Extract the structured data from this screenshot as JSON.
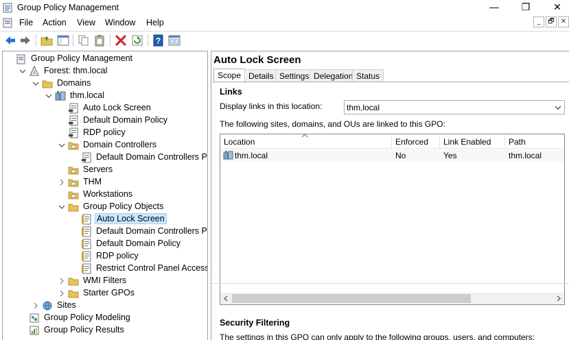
{
  "window": {
    "title": "Group Policy Management",
    "minimize_glyph": "—",
    "maximize_glyph": "❐",
    "close_glyph": "✕"
  },
  "menu": [
    "File",
    "Action",
    "View",
    "Window",
    "Help"
  ],
  "mdi": {
    "minimize": "_",
    "restore": "🗗",
    "close": "✕"
  },
  "toolbar": [
    "back-icon",
    "forward-icon",
    "up-folder-icon",
    "show-tree-icon",
    "copy-icon",
    "paste-icon",
    "delete-icon",
    "refresh-icon",
    "help-icon",
    "properties-icon"
  ],
  "tree": [
    {
      "label": "Group Policy Management",
      "icon": "gpm-icon",
      "twisty": "none"
    },
    {
      "label": "Forest: thm.local",
      "icon": "forest-icon",
      "twisty": "open"
    },
    {
      "label": "Domains",
      "icon": "folder-icon",
      "twisty": "open"
    },
    {
      "label": "thm.local",
      "icon": "domain-icon",
      "twisty": "open"
    },
    {
      "label": "Auto Lock Screen",
      "icon": "gpo-link-icon",
      "twisty": "none"
    },
    {
      "label": "Default Domain Policy",
      "icon": "gpo-link-icon",
      "twisty": "none"
    },
    {
      "label": "RDP policy",
      "icon": "gpo-link-icon",
      "twisty": "none"
    },
    {
      "label": "Domain Controllers",
      "icon": "ou-folder-icon",
      "twisty": "open"
    },
    {
      "label": "Default Domain Controllers Policy",
      "icon": "gpo-link-icon",
      "twisty": "none"
    },
    {
      "label": "Servers",
      "icon": "ou-folder-icon",
      "twisty": "none"
    },
    {
      "label": "THM",
      "icon": "ou-folder-icon",
      "twisty": "closed"
    },
    {
      "label": "Workstations",
      "icon": "ou-folder-icon",
      "twisty": "none"
    },
    {
      "label": "Group Policy Objects",
      "icon": "folder-icon",
      "twisty": "open"
    },
    {
      "label": "Auto Lock Screen",
      "icon": "gpo-icon",
      "twisty": "none",
      "selected": true
    },
    {
      "label": "Default Domain Controllers Policy",
      "icon": "gpo-icon",
      "twisty": "none"
    },
    {
      "label": "Default Domain Policy",
      "icon": "gpo-icon",
      "twisty": "none"
    },
    {
      "label": "RDP policy",
      "icon": "gpo-icon",
      "twisty": "none"
    },
    {
      "label": "Restrict Control Panel Access",
      "icon": "gpo-icon",
      "twisty": "none"
    },
    {
      "label": "WMI Filters",
      "icon": "folder-icon",
      "twisty": "closed"
    },
    {
      "label": "Starter GPOs",
      "icon": "folder-icon",
      "twisty": "closed"
    },
    {
      "label": "Sites",
      "icon": "sites-icon",
      "twisty": "closed"
    },
    {
      "label": "Group Policy Modeling",
      "icon": "modeling-icon",
      "twisty": "none"
    },
    {
      "label": "Group Policy Results",
      "icon": "results-icon",
      "twisty": "none"
    }
  ],
  "details": {
    "title": "Auto Lock Screen",
    "tabs": [
      "Scope",
      "Details",
      "Settings",
      "Delegation",
      "Status"
    ],
    "active_tab": "Scope",
    "links_heading": "Links",
    "display_links_label": "Display links in this location:",
    "display_links_value": "thm.local",
    "linked_text": "The following sites, domains, and OUs are linked to this GPO:",
    "columns": [
      "Location",
      "Enforced",
      "Link Enabled",
      "Path"
    ],
    "rows": [
      {
        "location": "thm.local",
        "enforced": "No",
        "link_enabled": "Yes",
        "path": "thm.local"
      }
    ],
    "security_heading": "Security Filtering",
    "security_text": "The settings in this GPO can only apply to the following groups, users, and computers:"
  },
  "colors": {
    "selection": "#cce8ff",
    "accent_blue": "#1e73d2",
    "folder": "#e8c25a",
    "delete_red": "#d42a2a"
  }
}
